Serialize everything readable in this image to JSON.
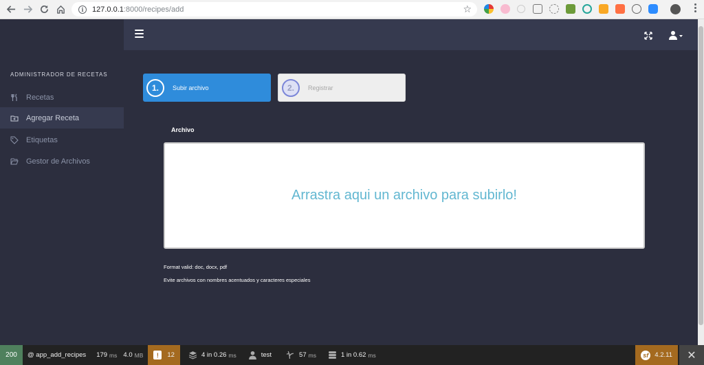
{
  "browser": {
    "url_host": "127.0.0.1",
    "url_path": ":8000/recipes/add"
  },
  "sidebar": {
    "title": "ADMINISTRADOR DE RECETAS",
    "items": [
      {
        "label": "Recetas",
        "icon": "cutlery-icon"
      },
      {
        "label": "Agregar Receta",
        "icon": "folder-add-icon",
        "active": true
      },
      {
        "label": "Etiquetas",
        "icon": "tags-icon"
      },
      {
        "label": "Gestor de Archivos",
        "icon": "folder-open-icon"
      }
    ]
  },
  "steps": [
    {
      "number": "1.",
      "label": "Subir archivo",
      "active": true
    },
    {
      "number": "2.",
      "label": "Registrar",
      "active": false
    }
  ],
  "form": {
    "field_label": "Archivo",
    "dropzone_text": "Arrastra aqui un archivo para subirlo!",
    "hint_formats": "Format valid: doc, docx, pdf",
    "hint_names": "Evite archivos con nombres acentuados y caracteres especiales"
  },
  "debug_toolbar": {
    "status": "200",
    "route": "@ app_add_recipes",
    "time": "179",
    "time_unit": "ms",
    "memory": "4.0",
    "memory_unit": "MB",
    "warnings": "12",
    "cache": "4 in 0.26",
    "cache_unit": "ms",
    "user": "test",
    "twig": "57",
    "twig_unit": "ms",
    "db": "1 in 0.62",
    "db_unit": "ms",
    "version": "4.2.11"
  },
  "colors": {
    "primary": "#2f8cdb",
    "dropzone_text": "#62b7d1",
    "sidebar_bg": "#2c2e3e",
    "header_bg": "#363a4f",
    "toolbar_status": "#4f805d",
    "toolbar_warn": "#a46a1f"
  }
}
